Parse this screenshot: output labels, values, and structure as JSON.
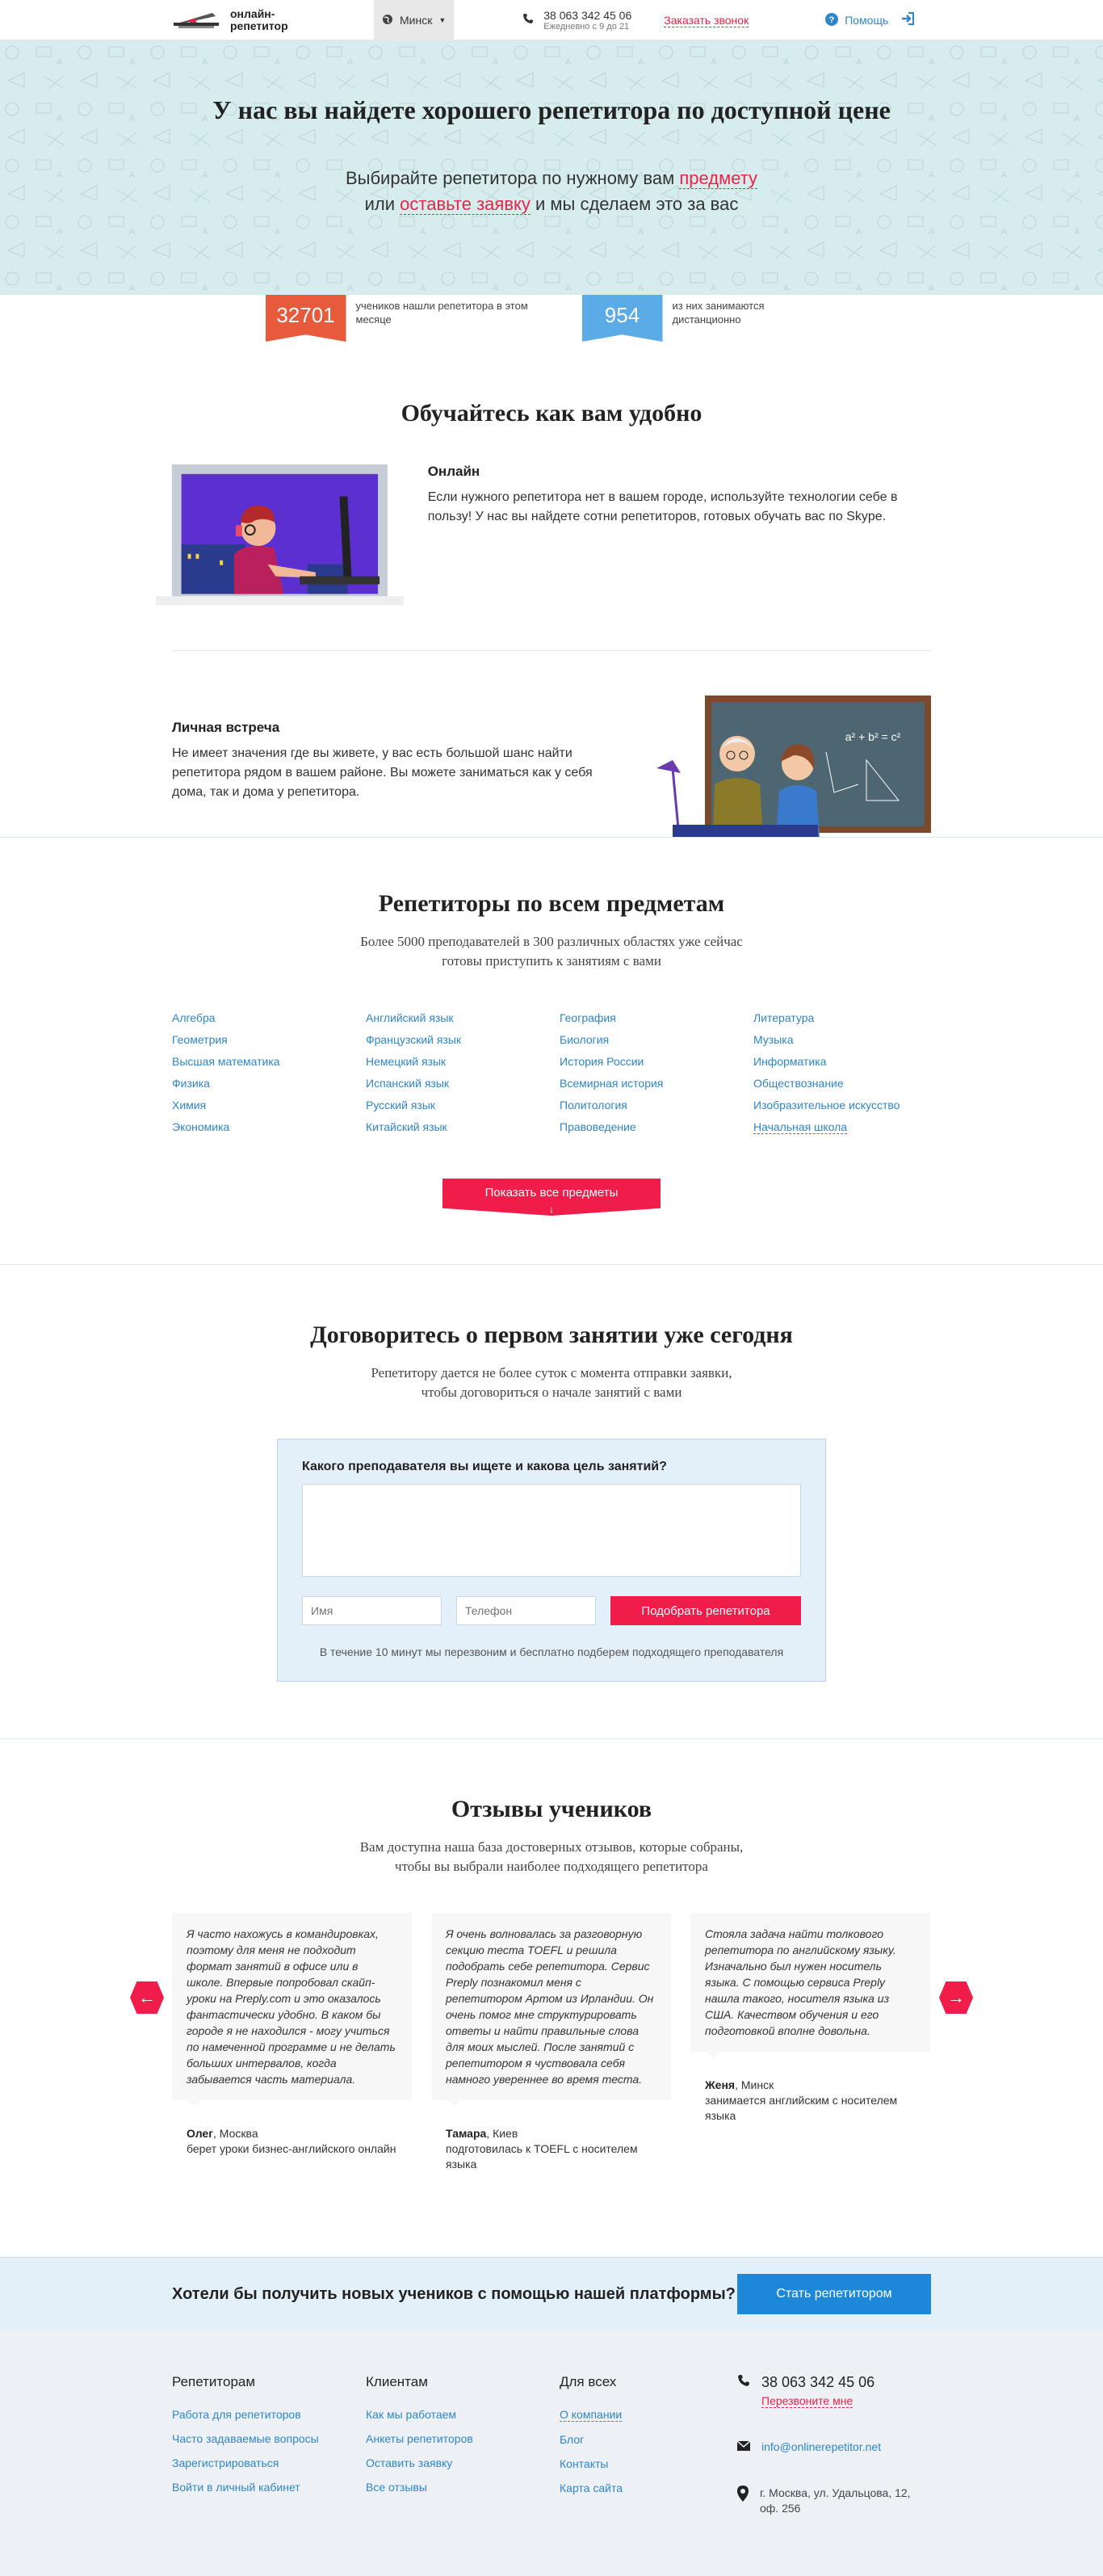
{
  "header": {
    "logo_text_1": "онлайн-",
    "logo_text_2": "репетитор",
    "city": "Минск",
    "phone": "38 063 342 45 06",
    "hours": "Ежедневно с 9 до 21",
    "call_link": "Заказать звонок",
    "help": "Помощь"
  },
  "hero": {
    "title": "У нас вы найдете хорошего репетитора по доступной цене",
    "line1_pre": "Выбирайте репетитора по нужному вам ",
    "line1_link": "предмету",
    "line2_pre": "или ",
    "line2_link": "оставьте заявку",
    "line2_post": " и мы сделаем это за вас"
  },
  "stats": [
    {
      "value": "32701",
      "text": "учеников нашли репетитора в этом месяце",
      "color": "#e85a3c"
    },
    {
      "value": "954",
      "text": "из них занимаются дистанционно",
      "color": "#5aabe6"
    }
  ],
  "learn": {
    "title": "Обучайтесь как вам удобно",
    "online_title": "Онлайн",
    "online_text": "Если нужного репетитора нет в вашем городе, используйте технологии себе в пользу! У нас вы найдете сотни репетиторов, готовых обучать вас по Skype.",
    "meet_title": "Личная встреча",
    "meet_text": "Не имеет значения где вы живете, у вас есть большой шанс найти репетитора рядом в вашем районе. Вы можете заниматься как у себя дома, так и дома у репетитора.",
    "board_formula": "a² + b² = c²"
  },
  "subjects": {
    "title": "Репетиторы по всем предметам",
    "subtitle_1": "Более 5000 преподавателей в 300 различных областях уже сейчас",
    "subtitle_2": "готовы приступить к занятиям с вами",
    "items": [
      "Алгебра",
      "Английский язык",
      "География",
      "Литература",
      "Геометрия",
      "Французский язык",
      "Биология",
      "Музыка",
      "Высшая математика",
      "Немецкий язык",
      "История России",
      "Информатика",
      "Физика",
      "Испанский язык",
      "Всемирная история",
      "Обществознание",
      "Химия",
      "Русский язык",
      "Политология",
      "Изобразительное искусство",
      "Экономика",
      "Китайский язык",
      "Правоведение",
      "Начальная школа"
    ],
    "show_all": "Показать все предметы"
  },
  "agree": {
    "title": "Договоритесь о первом занятии уже сегодня",
    "subtitle_1": "Репетитору дается не более суток с момента отправки заявки,",
    "subtitle_2": "чтобы договориться о начале занятий с вами",
    "question": "Какого преподавателя вы ищете и какова цель занятий?",
    "name_placeholder": "Имя",
    "phone_placeholder": "Телефон",
    "submit": "Подобрать репетитора",
    "note": "В течение 10 минут мы перезвоним и бесплатно подберем подходящего преподавателя"
  },
  "reviews": {
    "title": "Отзывы учеников",
    "subtitle_1": "Вам доступна наша база достоверных отзывов, которые собраны,",
    "subtitle_2": "чтобы вы выбрали наиболее подходящего репетитора",
    "items": [
      {
        "text": "Я часто нахожусь в командировках, поэтому для меня не подходит формат занятий в офисе или в школе. Впервые попробовал скайп-уроки на Preply.com и это оказалось фантастически удобно. В каком бы городе я не находился - могу учиться по намеченной программе и не делать больших интервалов, когда забывается часть материала.",
        "name": "Олег",
        "city": ", Москва",
        "info": "берет уроки бизнес-английского онлайн"
      },
      {
        "text": "Я очень волновалась за разговорную секцию теста TOEFL и решила подобрать себе репетитора. Сервис Preply познакомил меня с репетитором Артом из Ирландии. Он очень помог мне структурировать ответы и найти правильные слова для моих мыслей. После занятий с репетитором я чуствовала себя намного увереннее во время теста.",
        "name": "Тамара",
        "city": ", Киев",
        "info": "подготовилась к TOEFL с носителем языка"
      },
      {
        "text": "Стояла задача найти толкового репетитора по английскому языку. Изначально был нужен носитель языка. С помощью сервиса Preply нашла такого, носителя языка из США. Качеством обучения и его подготовкой вполне довольна.",
        "name": "Женя",
        "city": ", Минск",
        "info": "занимается английским с носителем языка"
      }
    ]
  },
  "cta": {
    "text": "Хотели бы получить новых учеников с помощью нашей платформы?",
    "button": "Стать репетитором"
  },
  "footer": {
    "col1_title": "Репетиторам",
    "col1": [
      "Работа для репетиторов",
      "Часто задаваемые вопросы",
      "Зарегистрироваться",
      "Войти в личный кабинет"
    ],
    "col2_title": "Клиентам",
    "col2": [
      "Как мы работаем",
      "Анкеты репетиторов",
      "Оставить заявку",
      "Все отзывы"
    ],
    "col3_title": "Для всех",
    "col3": [
      "О компании",
      "Блог",
      "Контакты",
      "Карта сайта"
    ],
    "phone": "38 063 342 45 06",
    "callback": "Перезвоните мне",
    "email": "info@onlinerepetitor.net",
    "address_1": "г. Москва, ул. Удальцова, 12,",
    "address_2": "оф. 256"
  },
  "colors": {
    "accent_red": "#f01d4b",
    "accent_blue": "#1e88d8",
    "hero_bg": "#d7ecec"
  }
}
